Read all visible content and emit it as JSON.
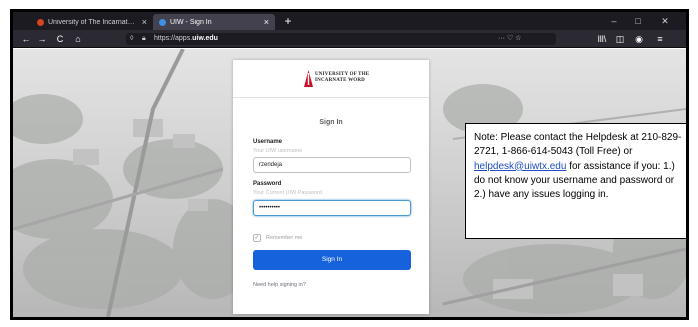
{
  "tabs": [
    {
      "title": "University of The Incarnate W...",
      "favicon_color": "#d6451d",
      "active": false
    },
    {
      "title": "UIW - Sign In",
      "favicon_color": "#3c91e6",
      "active": true
    }
  ],
  "window_controls": {
    "minimize": "–",
    "maximize": "□",
    "close": "✕"
  },
  "nav": {
    "back": "←",
    "forward": "→",
    "reload": "C",
    "home": "⌂",
    "url_prefix": "https://apps.",
    "url_domain": "uiw.edu",
    "url_right": "···  ♡  ☆",
    "library": "lll\\",
    "sidebar": "◫",
    "account": "◉",
    "menu": "≡"
  },
  "card": {
    "logo_line1": "UNIVERSITY OF THE",
    "logo_line2": "INCARNATE WORD",
    "title": "Sign In",
    "username_label": "Username",
    "username_hint": "Your UIW username",
    "username_value": "rzendeja",
    "password_label": "Password",
    "password_hint": "Your Current UIW Password",
    "password_value": "••••••••••",
    "remember_label": "Remember me",
    "remember_checked": true,
    "signin_button": "Sign In",
    "help_link": "Need help signing in?"
  },
  "note": {
    "text_before": "Note: Please contact the Helpdesk at 210-829-2721, 1-866-614-5043 (Toll Free) or ",
    "email": "helpdesk@uiwtx.edu",
    "text_after": " for assistance if you: 1.) do not know your username and password or 2.) have any issues logging in."
  },
  "colors": {
    "primary_button": "#1662dd",
    "logo_red": "#c8102e",
    "link": "#1f4ec4"
  }
}
